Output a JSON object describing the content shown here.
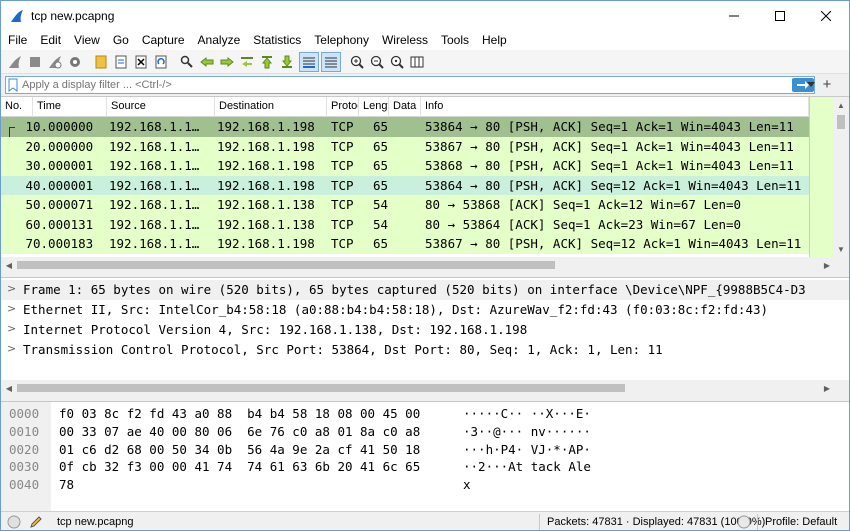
{
  "window": {
    "title": "tcp new.pcapng"
  },
  "menu": [
    "File",
    "Edit",
    "View",
    "Go",
    "Capture",
    "Analyze",
    "Statistics",
    "Telephony",
    "Wireless",
    "Tools",
    "Help"
  ],
  "filter": {
    "placeholder": "Apply a display filter ... <Ctrl-/>",
    "value": ""
  },
  "packet_list": {
    "columns": [
      "No.",
      "Time",
      "Source",
      "Destination",
      "Protoc",
      "Lengt",
      "Data",
      "Info"
    ],
    "rows": [
      {
        "no": "1",
        "time": "0.000000",
        "source": "192.168.1.1…",
        "destination": "192.168.1.198",
        "protocol": "TCP",
        "length": "65",
        "data": "",
        "info": "53864 → 80 [PSH, ACK] Seq=1 Ack=1 Win=4043 Len=11"
      },
      {
        "no": "2",
        "time": "0.000000",
        "source": "192.168.1.1…",
        "destination": "192.168.1.198",
        "protocol": "TCP",
        "length": "65",
        "data": "",
        "info": "53867 → 80 [PSH, ACK] Seq=1 Ack=1 Win=4043 Len=11"
      },
      {
        "no": "3",
        "time": "0.000001",
        "source": "192.168.1.1…",
        "destination": "192.168.1.198",
        "protocol": "TCP",
        "length": "65",
        "data": "",
        "info": "53868 → 80 [PSH, ACK] Seq=1 Ack=1 Win=4043 Len=11"
      },
      {
        "no": "4",
        "time": "0.000001",
        "source": "192.168.1.1…",
        "destination": "192.168.1.198",
        "protocol": "TCP",
        "length": "65",
        "data": "",
        "info": "53864 → 80 [PSH, ACK] Seq=12 Ack=1 Win=4043 Len=11"
      },
      {
        "no": "5",
        "time": "0.000071",
        "source": "192.168.1.1…",
        "destination": "192.168.1.138",
        "protocol": "TCP",
        "length": "54",
        "data": "",
        "info": "80 → 53868 [ACK] Seq=1 Ack=12 Win=67 Len=0"
      },
      {
        "no": "6",
        "time": "0.000131",
        "source": "192.168.1.1…",
        "destination": "192.168.1.138",
        "protocol": "TCP",
        "length": "54",
        "data": "",
        "info": "80 → 53864 [ACK] Seq=1 Ack=23 Win=67 Len=0"
      },
      {
        "no": "7",
        "time": "0.000183",
        "source": "192.168.1.1…",
        "destination": "192.168.1.198",
        "protocol": "TCP",
        "length": "65",
        "data": "",
        "info": "53867 → 80 [PSH, ACK] Seq=12 Ack=1 Win=4043 Len=11"
      }
    ]
  },
  "details": [
    "Frame 1: 65 bytes on wire (520 bits), 65 bytes captured (520 bits) on interface \\Device\\NPF_{9988B5C4-D3",
    "Ethernet II, Src: IntelCor_b4:58:18 (a0:88:b4:b4:58:18), Dst: AzureWav_f2:fd:43 (f0:03:8c:f2:fd:43)",
    "Internet Protocol Version 4, Src: 192.168.1.138, Dst: 192.168.1.198",
    "Transmission Control Protocol, Src Port: 53864, Dst Port: 80, Seq: 1, Ack: 1, Len: 11"
  ],
  "hex": [
    {
      "offset": "0000",
      "bytes": "f0 03 8c f2 fd 43 a0 88  b4 b4 58 18 08 00 45 00",
      "ascii": "·····C·· ··X···E·"
    },
    {
      "offset": "0010",
      "bytes": "00 33 07 ae 40 00 80 06  6e 76 c0 a8 01 8a c0 a8",
      "ascii": "·3··@··· nv······"
    },
    {
      "offset": "0020",
      "bytes": "01 c6 d2 68 00 50 34 0b  56 4a 9e 2a cf 41 50 18",
      "ascii": "···h·P4· VJ·*·AP·"
    },
    {
      "offset": "0030",
      "bytes": "0f cb 32 f3 00 00 41 74  74 61 63 6b 20 41 6c 65",
      "ascii": "··2···At tack Ale"
    },
    {
      "offset": "0040",
      "bytes": "78",
      "ascii": "x"
    }
  ],
  "status": {
    "file": "tcp new.pcapng",
    "packets": "Packets: 47831 · Displayed: 47831 (100.0%)",
    "profile": "Profile: Default"
  },
  "colors": {
    "row_green": "#e4ffc7",
    "row_selected": "#a0c090",
    "accent": "#3b8dd4"
  },
  "icons": {
    "toolbar": [
      "shark-fin-start-icon",
      "stop-icon",
      "restart-icon",
      "capture-options-icon",
      "open-file-icon",
      "save-file-icon",
      "close-file-icon",
      "reload-icon",
      "find-packet-icon",
      "go-back-icon",
      "go-forward-icon",
      "go-to-packet-icon",
      "go-first-icon",
      "go-last-icon",
      "autoscroll-icon",
      "colorize-icon",
      "zoom-in-icon",
      "zoom-out-icon",
      "zoom-normal-icon",
      "resize-columns-icon"
    ]
  }
}
